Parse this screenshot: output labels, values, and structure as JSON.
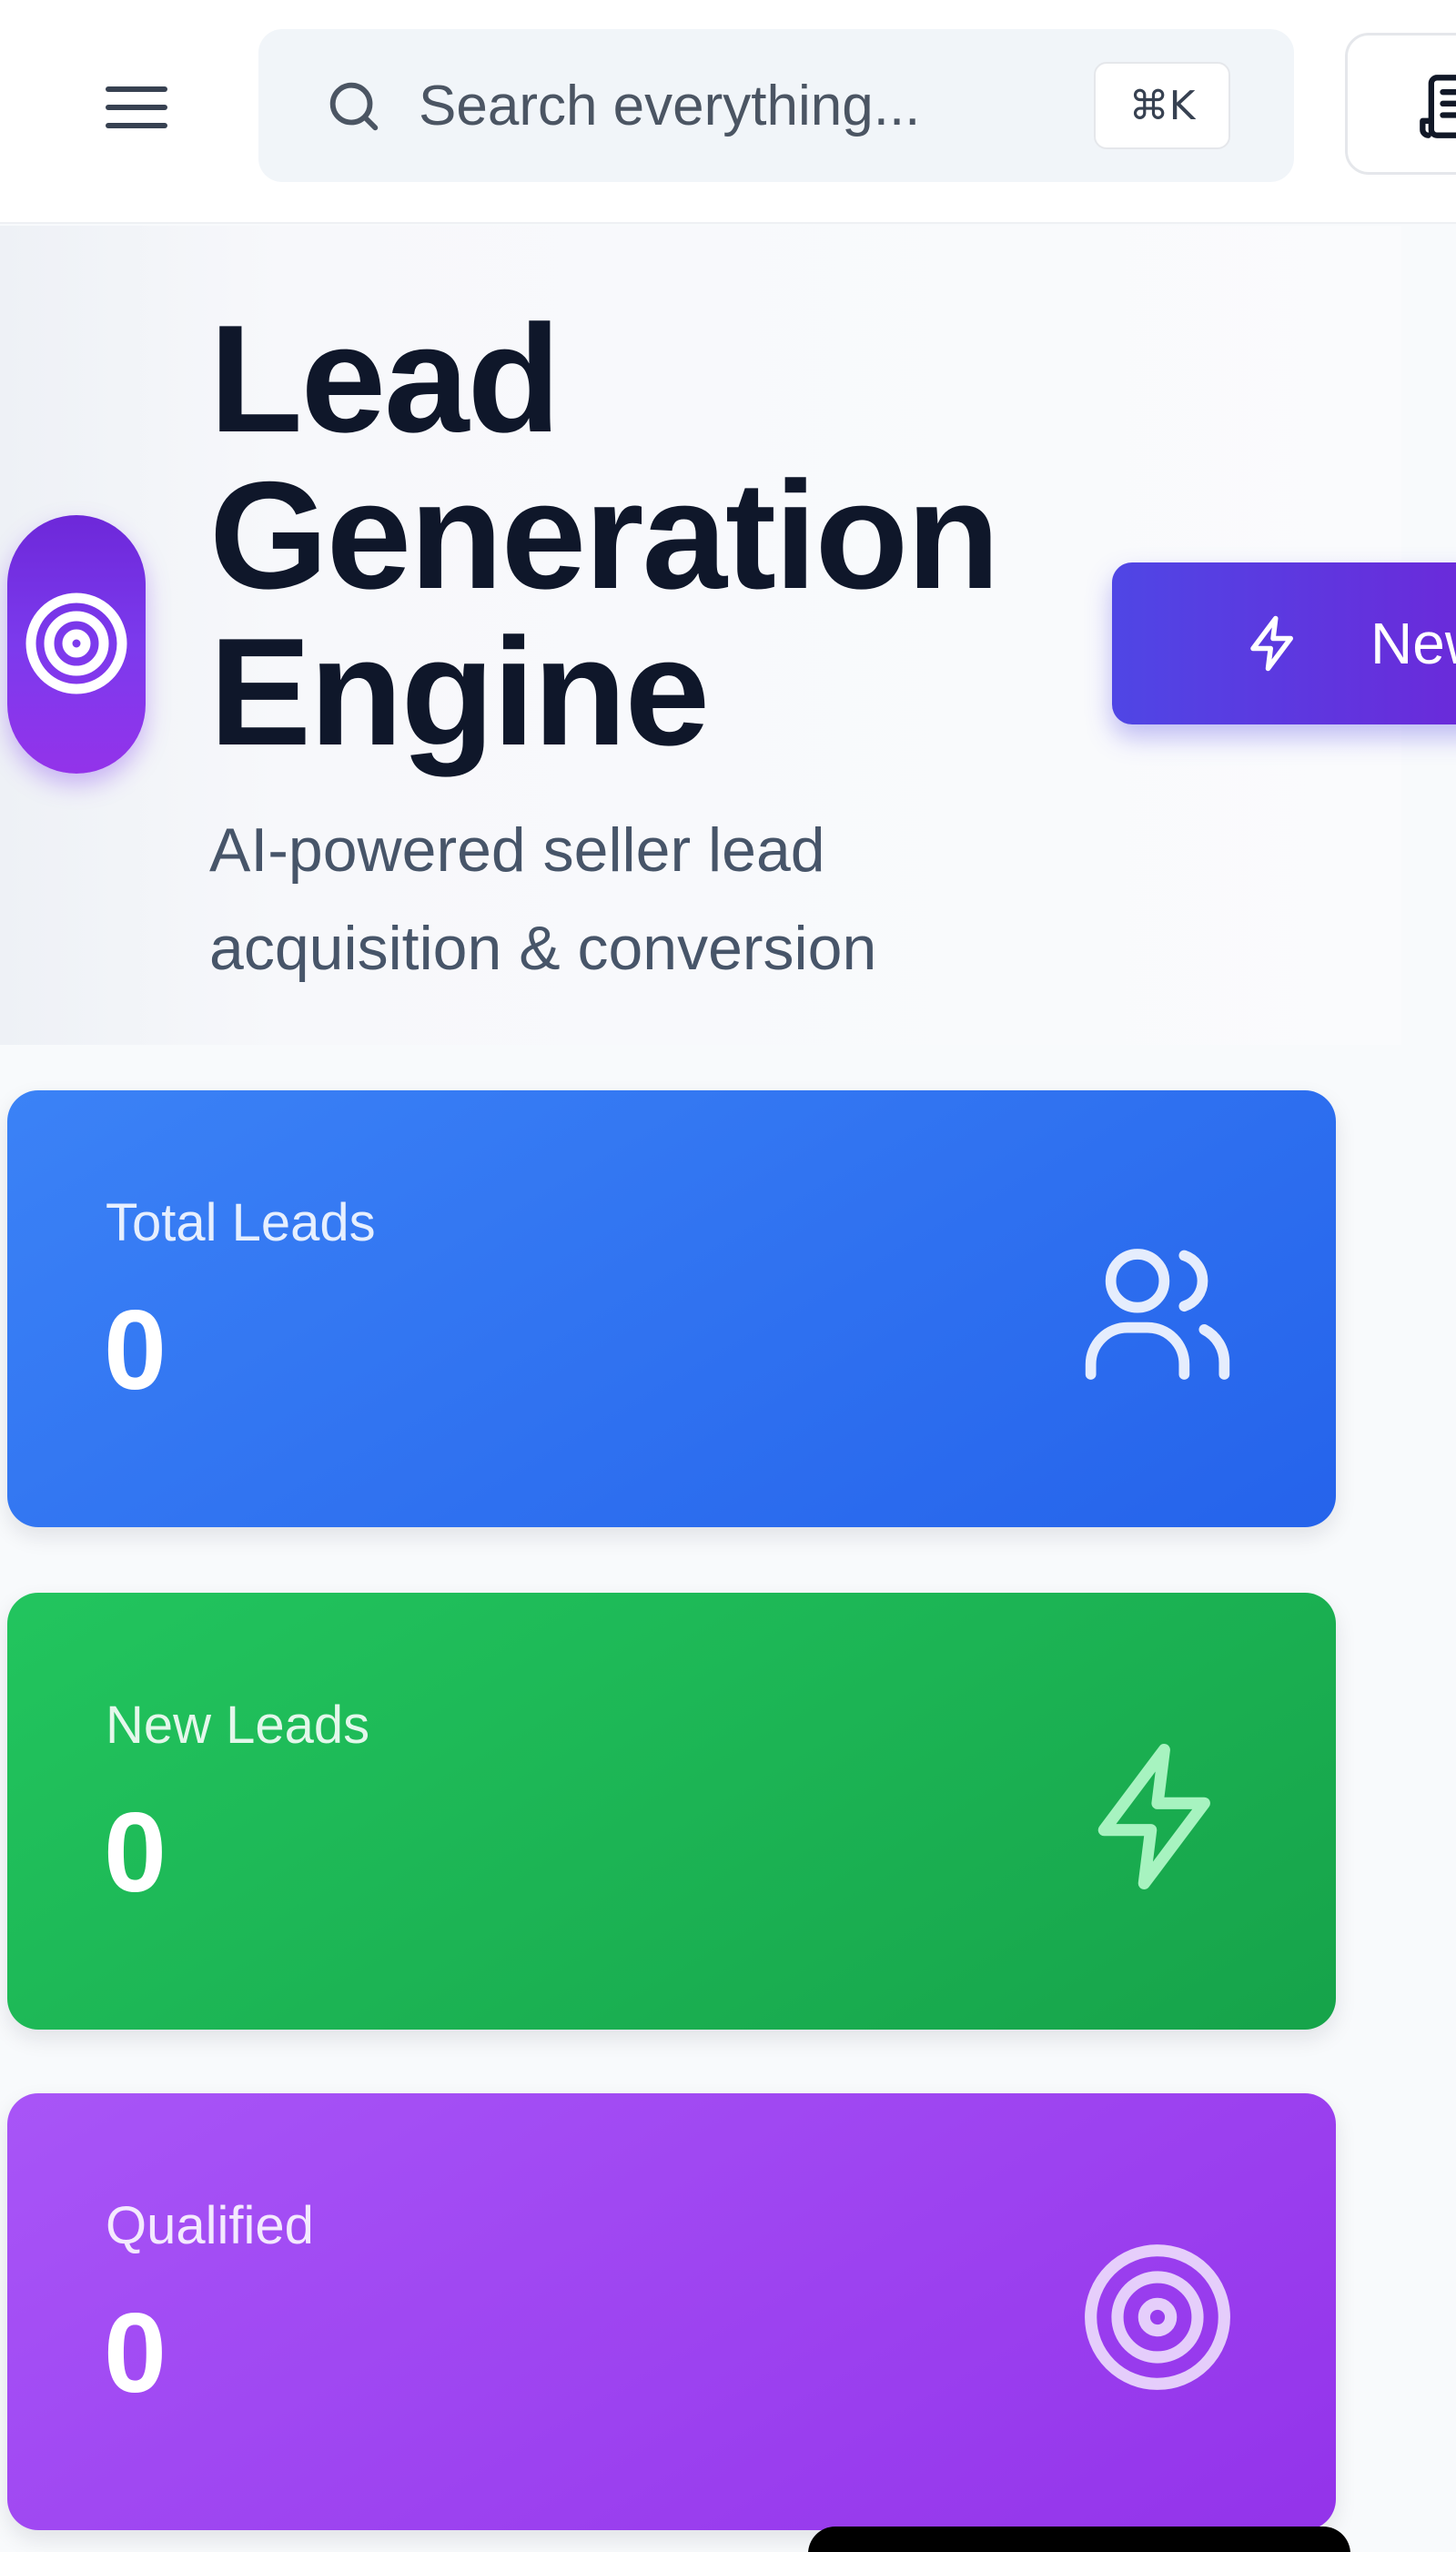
{
  "topbar": {
    "search": {
      "placeholder": "Search everything...",
      "shortcut": "⌘K"
    }
  },
  "hero": {
    "title_lines": [
      "Lead",
      "Generation",
      "Engine"
    ],
    "subtitle_lines": [
      "AI-powered seller lead",
      "acquisition & conversion"
    ],
    "new_button_label": "New"
  },
  "stats": [
    {
      "label": "Total Leads",
      "value": "0",
      "icon": "users-icon",
      "color": "#2563eb"
    },
    {
      "label": "New Leads",
      "value": "0",
      "icon": "zap-icon",
      "color": "#16a34a"
    },
    {
      "label": "Qualified",
      "value": "0",
      "icon": "target-icon",
      "color": "#9333ea"
    }
  ],
  "colors": {
    "accent": "#6d28d9",
    "primary_button": "#4f46e5",
    "title": "#0f172a",
    "subtitle": "#475569"
  }
}
